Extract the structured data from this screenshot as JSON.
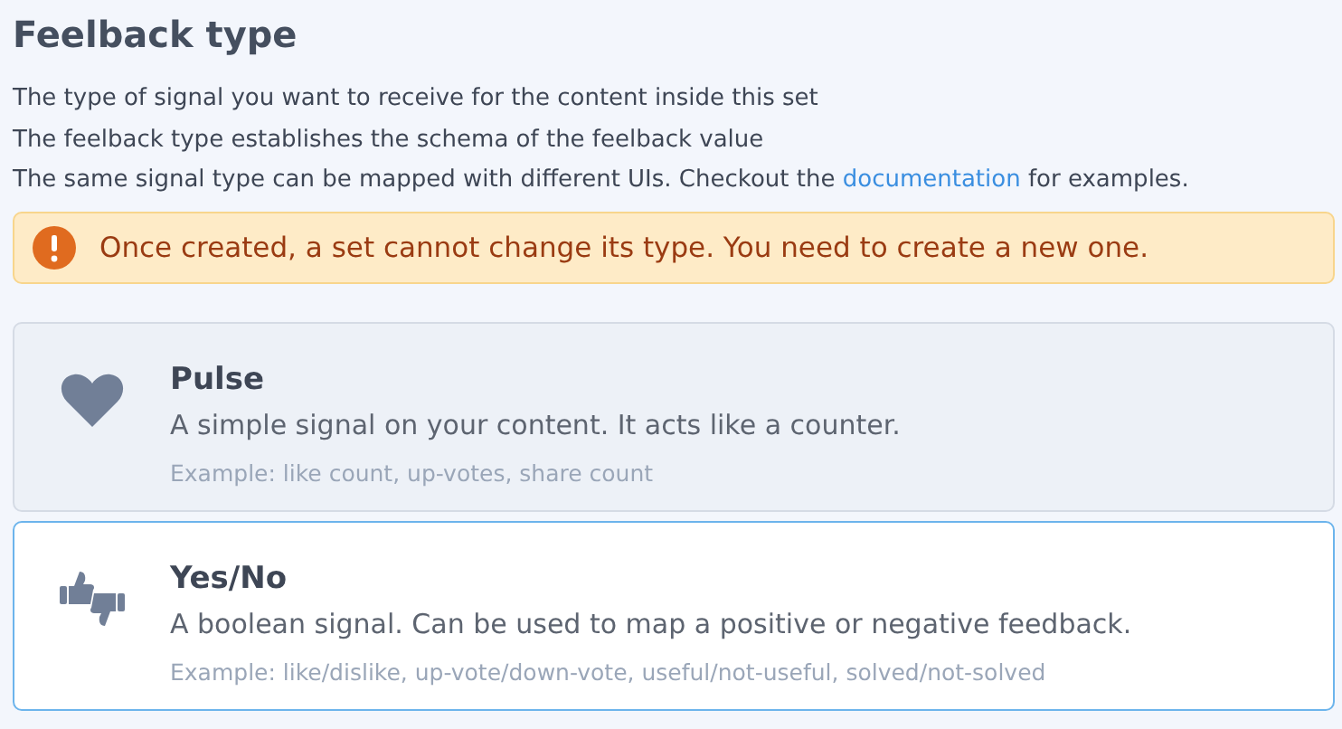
{
  "title": "Feelback type",
  "description": [
    {
      "text": "The type of signal you want to receive for the content inside this set"
    },
    {
      "text": "The feelback type establishes the schema of the feelback value"
    },
    {
      "text": "The same signal type can be mapped with different UIs. Checkout the ",
      "link": "documentation",
      "after": " for examples."
    }
  ],
  "alert": {
    "message": "Once created, a set cannot change its type. You need to create a new one."
  },
  "options": [
    {
      "kind": "heart",
      "name": "Pulse",
      "description": "A simple signal on your content. It acts like a counter.",
      "example": "Example: like count, up-votes, share count",
      "selected": false
    },
    {
      "kind": "thumbs",
      "name": "Yes/No",
      "description": "A boolean signal. Can be used to map a positive or negative feedback.",
      "example": "Example: like/dislike, up-vote/down-vote, useful/not-useful, solved/not-solved",
      "selected": true
    }
  ]
}
